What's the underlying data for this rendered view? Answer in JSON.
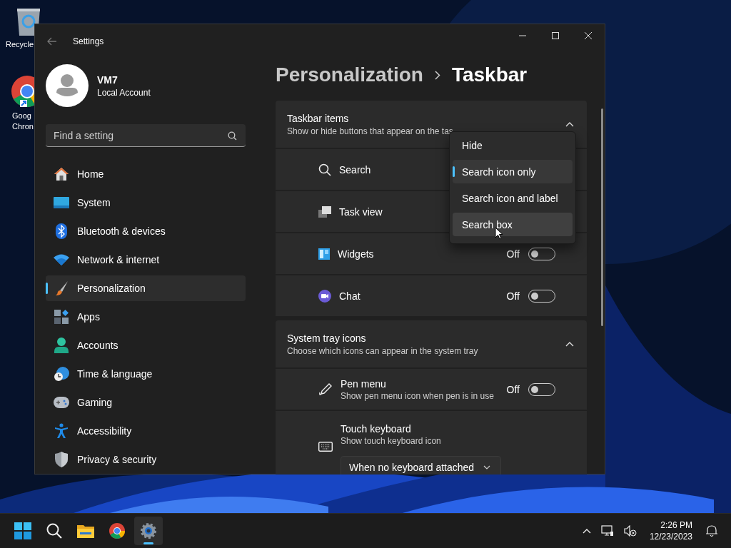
{
  "desktop_icons": [
    {
      "label": "Recycle"
    },
    {
      "label": "Goog\nChron"
    }
  ],
  "window": {
    "title": "Settings"
  },
  "account": {
    "name": "VM7",
    "type": "Local Account"
  },
  "search": {
    "placeholder": "Find a setting"
  },
  "nav": [
    {
      "label": "Home",
      "selected": false
    },
    {
      "label": "System",
      "selected": false
    },
    {
      "label": "Bluetooth & devices",
      "selected": false
    },
    {
      "label": "Network & internet",
      "selected": false
    },
    {
      "label": "Personalization",
      "selected": true
    },
    {
      "label": "Apps",
      "selected": false
    },
    {
      "label": "Accounts",
      "selected": false
    },
    {
      "label": "Time & language",
      "selected": false
    },
    {
      "label": "Gaming",
      "selected": false
    },
    {
      "label": "Accessibility",
      "selected": false
    },
    {
      "label": "Privacy & security",
      "selected": false
    }
  ],
  "breadcrumb": [
    "Personalization",
    "Taskbar"
  ],
  "sections": [
    {
      "title": "Taskbar items",
      "description": "Show or hide buttons that appear on the tas",
      "expanded": true,
      "rows": [
        {
          "kind": "plain",
          "label": "Search"
        },
        {
          "kind": "plain",
          "label": "Task view"
        },
        {
          "kind": "toggle",
          "label": "Widgets",
          "state_label": "Off",
          "on": false
        },
        {
          "kind": "toggle",
          "label": "Chat",
          "state_label": "Off",
          "on": false
        }
      ]
    },
    {
      "title": "System tray icons",
      "description": "Choose which icons can appear in the system tray",
      "expanded": true,
      "rows": [
        {
          "kind": "toggle",
          "label": "Pen menu",
          "description": "Show pen menu icon when pen is in use",
          "state_label": "Off",
          "on": false
        },
        {
          "kind": "dropdown",
          "label": "Touch keyboard",
          "description": "Show touch keyboard icon",
          "value": "When no keyboard attached"
        }
      ]
    }
  ],
  "dropdown_menu": {
    "options": [
      {
        "label": "Hide",
        "selected": false,
        "hovered": false
      },
      {
        "label": "Search icon only",
        "selected": true,
        "hovered": false
      },
      {
        "label": "Search icon and label",
        "selected": false,
        "hovered": false
      },
      {
        "label": "Search box",
        "selected": false,
        "hovered": true
      }
    ]
  },
  "taskbar": {
    "time": "2:26 PM",
    "date": "12/23/2023"
  }
}
